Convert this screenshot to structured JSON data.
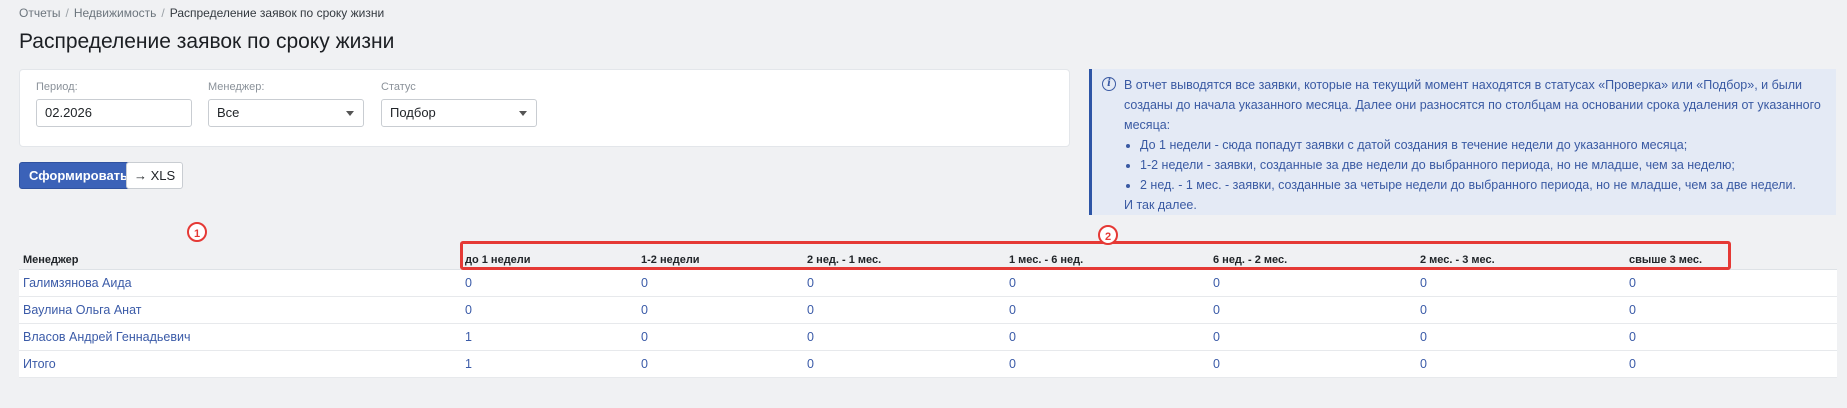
{
  "breadcrumb": {
    "items": [
      "Отчеты",
      "Недвижимость",
      "Распределение заявок по сроку жизни"
    ],
    "separator": "/"
  },
  "page": {
    "title": "Распределение заявок по сроку жизни"
  },
  "filters": {
    "period": {
      "label": "Период:",
      "value": "02.2026"
    },
    "manager": {
      "label": "Менеджер:",
      "value": "Все"
    },
    "status": {
      "label": "Статус",
      "value": "Подбор"
    }
  },
  "actions": {
    "generate_label": "Сформировать",
    "xls_label": "→ XLS"
  },
  "info": {
    "intro": "В отчет выводятся все заявки, которые на текущий момент находятся в статусах «Проверка» или «Подбор», и были созданы до начала указанного месяца. Далее они разносятся по столбцам на основании срока удаления от указанного месяца:",
    "items": [
      "До 1 недели - сюда попадут заявки с датой создания в течение недели до указанного месяца;",
      "1-2 недели - заявки, созданные за две недели до выбранного периода, но не младше, чем за неделю;",
      "2 нед. - 1 мес. - заявки, созданные за четыре недели до выбранного периода, но не младше, чем за две недели."
    ],
    "outro": "И так далее."
  },
  "markers": [
    "1",
    "2"
  ],
  "table": {
    "headers": [
      "Менеджер",
      "до 1 недели",
      "1-2 недели",
      "2 нед. - 1 мес.",
      "1 мес. - 6 нед.",
      "6 нед. - 2 мес.",
      "2 мес. - 3 мес.",
      "свыше 3 мес."
    ],
    "rows": [
      {
        "manager": "Галимзянова Аида",
        "values": [
          "0",
          "0",
          "0",
          "0",
          "0",
          "0",
          "0"
        ]
      },
      {
        "manager": "Ваулина Ольга Анат",
        "values": [
          "0",
          "0",
          "0",
          "0",
          "0",
          "0",
          "0"
        ]
      },
      {
        "manager": "Власов Андрей Геннадьевич",
        "values": [
          "1",
          "0",
          "0",
          "0",
          "0",
          "0",
          "0"
        ]
      },
      {
        "manager": "Итого",
        "values": [
          "1",
          "0",
          "0",
          "0",
          "0",
          "0",
          "0"
        ]
      }
    ]
  },
  "colors": {
    "primary": "#3b62b8",
    "link": "#3b5ba8",
    "info_bg": "#e4eaf5",
    "marker": "#e53935"
  }
}
